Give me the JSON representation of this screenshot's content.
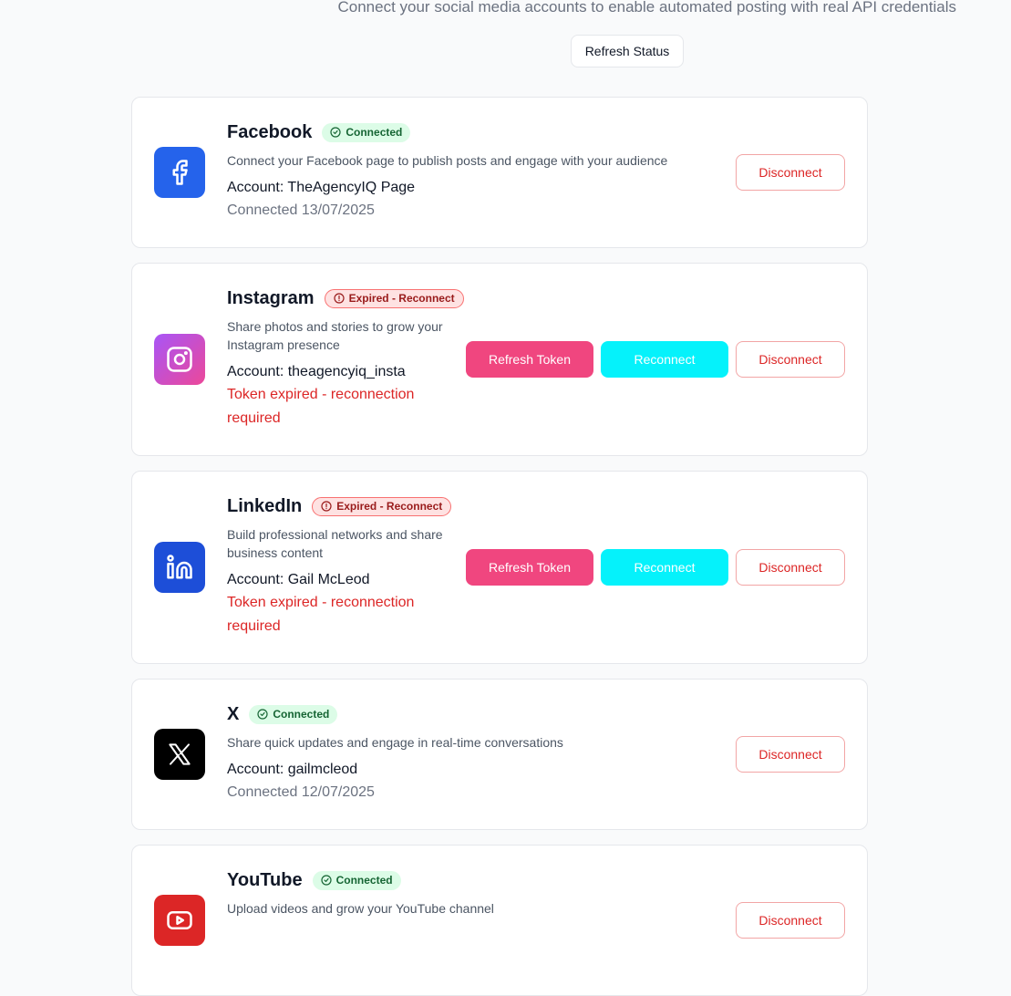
{
  "header": {
    "subtitle": "Connect your social media accounts to enable automated posting with real API credentials",
    "refresh_label": "Refresh Status"
  },
  "colors": {
    "facebook": "#2563eb",
    "instagram_gradient": [
      "#a855f7",
      "#ec4899"
    ],
    "linkedin": "#1d4ed8",
    "x": "#000000",
    "youtube": "#dc2626",
    "refresh_token": "#f0467f",
    "reconnect": "#05f2fb"
  },
  "accounts": [
    {
      "name": "Facebook",
      "icon": "facebook-icon",
      "status": "Connected",
      "description": "Connect your Facebook page to publish posts and engage with your audience",
      "account": "Account: TheAgencyIQ Page",
      "meta": "Connected 13/07/2025",
      "disconnect_label": "Disconnect"
    },
    {
      "name": "Instagram",
      "icon": "instagram-icon",
      "status": "Expired - Reconnect",
      "description": "Share photos and stories to grow your Instagram presence",
      "account": "Account: theagencyiq_insta",
      "meta": "Token expired - reconnection required",
      "refresh_label": "Refresh Token",
      "reconnect_label": "Reconnect",
      "disconnect_label": "Disconnect"
    },
    {
      "name": "LinkedIn",
      "icon": "linkedin-icon",
      "status": "Expired - Reconnect",
      "description": "Build professional networks and share business content",
      "account": "Account: Gail McLeod",
      "meta": "Token expired - reconnection required",
      "refresh_label": "Refresh Token",
      "reconnect_label": "Reconnect",
      "disconnect_label": "Disconnect"
    },
    {
      "name": "X",
      "icon": "x-icon",
      "status": "Connected",
      "description": "Share quick updates and engage in real-time conversations",
      "account": "Account: gailmcleod",
      "meta": "Connected 12/07/2025",
      "disconnect_label": "Disconnect"
    },
    {
      "name": "YouTube",
      "icon": "youtube-icon",
      "status": "Connected",
      "description": "Upload videos and grow your YouTube channel",
      "disconnect_label": "Disconnect"
    }
  ]
}
